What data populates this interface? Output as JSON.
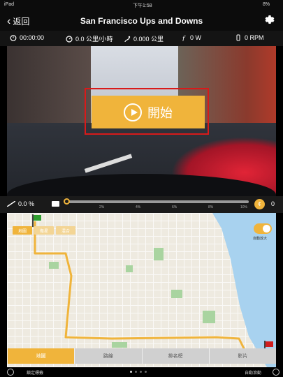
{
  "status_bar": {
    "left": "iPad",
    "time": "下午1:58",
    "battery": "8%"
  },
  "nav": {
    "back_label": "返回",
    "title": "San Francisco Ups and Downs"
  },
  "stats": {
    "elapsed": "00:00:00",
    "speed": "0.0 公里/小時",
    "distance": "0.000 公里",
    "power": "0 W",
    "cadence": "0 RPM"
  },
  "video": {
    "start_label": "開始"
  },
  "timeline": {
    "grade": "0.0 %",
    "progress": 0,
    "ticks": [
      "2%",
      "4%",
      "6%",
      "8%",
      "10%"
    ],
    "coin_symbol": "¢",
    "coin_count": "0"
  },
  "map": {
    "view_tabs": [
      {
        "label": "地圖",
        "active": true
      },
      {
        "label": "衛星",
        "active": false
      },
      {
        "label": "混合",
        "active": false
      }
    ],
    "auto_toggle_label": "自動放大",
    "auto_toggle_on": true
  },
  "bottom_tabs": [
    {
      "label": "地圖",
      "active": true
    },
    {
      "label": "路線",
      "active": false
    },
    {
      "label": "排名榜",
      "active": false
    },
    {
      "label": "影片",
      "active": false
    }
  ],
  "footer": {
    "lock_label": "鎖定標籤",
    "auto_label": "自動滾動"
  },
  "colors": {
    "accent": "#f0b43b",
    "highlight": "#d81a1a"
  }
}
